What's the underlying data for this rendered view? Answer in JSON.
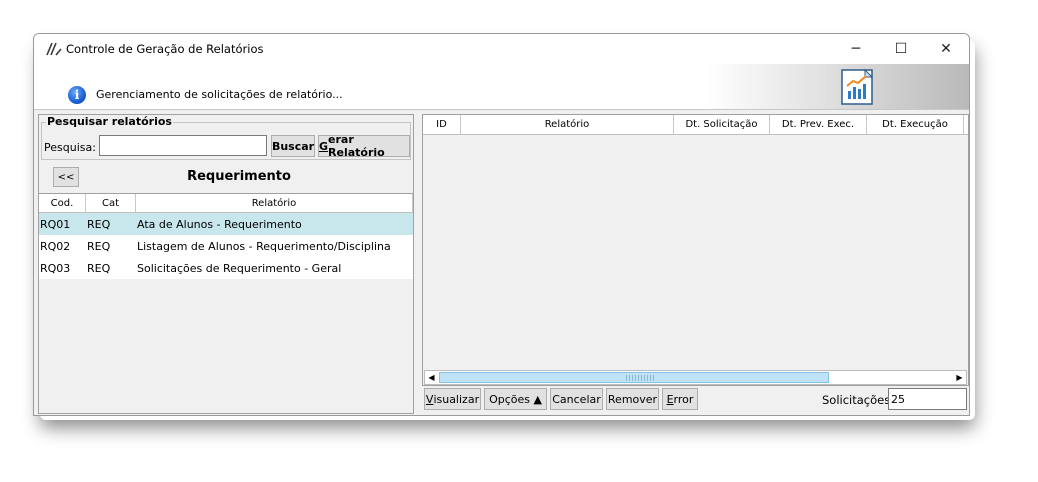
{
  "window": {
    "title": "Controle de Geração de Relatórios",
    "minimize": "─",
    "maximize": "☐",
    "close": "✕"
  },
  "banner": {
    "info_glyph": "i",
    "text": "Gerenciamento de solicitações de relatório..."
  },
  "search": {
    "group_title": "Pesquisar relatórios",
    "label": "Pesquisa:",
    "value": "",
    "search_button_label": "Buscar",
    "generate_button_prefix": "",
    "generate_button_hotkey": "G",
    "generate_button_rest": "erar Relatório"
  },
  "left": {
    "back_label": "<<",
    "section_title": "Requerimento",
    "columns": [
      "Cod.",
      "Cat",
      "Relatório"
    ],
    "rows": [
      {
        "cod": "RQ01",
        "cat": "REQ",
        "relatorio": "Ata de Alunos - Requerimento"
      },
      {
        "cod": "RQ02",
        "cat": "REQ",
        "relatorio": "Listagem de Alunos - Requerimento/Disciplina"
      },
      {
        "cod": "RQ03",
        "cat": "REQ",
        "relatorio": "Solicitações de Requerimento - Geral"
      }
    ]
  },
  "right": {
    "columns": [
      "ID",
      "Relatório",
      "Dt. Solicitação",
      "Dt. Prev. Exec.",
      "Dt. Execução"
    ],
    "scroll_left": "◀",
    "scroll_right": "▶"
  },
  "actions": {
    "visualizar_hotkey": "V",
    "visualizar_rest": "isualizar",
    "opcoes_label": "Opções ▲",
    "cancelar_label": "Cancelar",
    "remover_label": "Remover",
    "error_hotkey": "E",
    "error_rest": "rror",
    "solicitacoes_label": "Solicitações:",
    "solicitacoes_value": "25"
  },
  "colors": {
    "selected_row": "#c7e7ec",
    "button_face": "#e1e1e1",
    "scroll_thumb": "#bfe2f7"
  }
}
